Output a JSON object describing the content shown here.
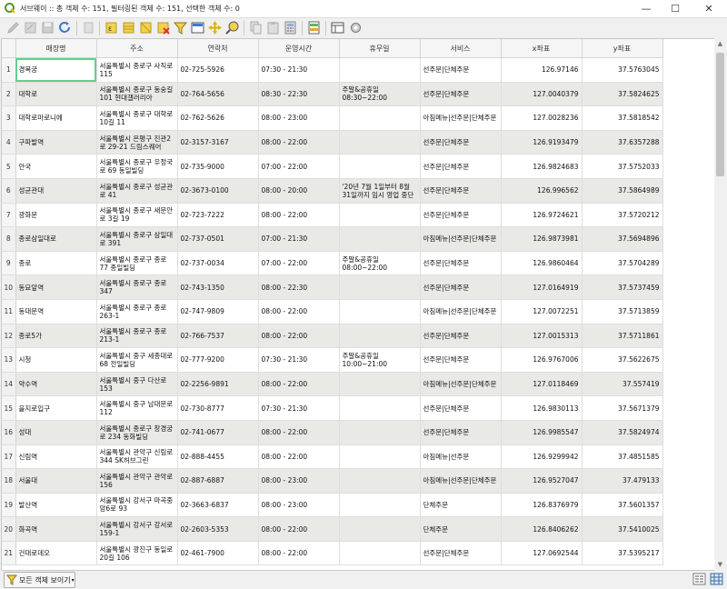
{
  "window": {
    "title": "서브웨이 :: 총 객체 수: 151, 필터링된 객체 수: 151, 선택한 객체 수: 0",
    "minimize": "—",
    "maximize": "☐",
    "close": "✕"
  },
  "toolbar": {
    "icons": [
      "edit-pencil-icon",
      "multi-edit-icon",
      "save-icon",
      "reload-icon",
      "add-feature-icon",
      "delete-feature-icon",
      "select-expression-icon",
      "select-all-icon",
      "invert-selection-icon",
      "deselect-icon",
      "filter-icon",
      "move-selection-top-icon",
      "pan-to-selection-icon",
      "zoom-to-selection-icon",
      "copy-icon",
      "paste-icon",
      "field-calculator-icon",
      "conditional-formatting-icon",
      "dock-table-icon",
      "actions-icon"
    ]
  },
  "table": {
    "columns": [
      "매장명",
      "주소",
      "연락처",
      "운영시간",
      "휴무일",
      "서비스",
      "x좌표",
      "y좌표"
    ],
    "rows": [
      {
        "n": "1",
        "name": "경복궁",
        "addr": "서울특별시 종로구 사직로 115",
        "tel": "02-725-5926",
        "hours": "07:30 - 21:30",
        "off": "",
        "svc": "선주문|단체주문",
        "x": "126.97146",
        "y": "37.5763045"
      },
      {
        "n": "2",
        "name": "대학로",
        "addr": "서울특별시 종로구 동숭길 101 현대갤러리아",
        "tel": "02-764-5656",
        "hours": "08:30 - 22:30",
        "off": "주말&공휴일 08:30~22:00",
        "svc": "선주문|단체주문",
        "x": "127.0040379",
        "y": "37.5824625"
      },
      {
        "n": "3",
        "name": "대학로마로니에",
        "addr": "서울특별시 종로구 대학로10길 11",
        "tel": "02-762-5626",
        "hours": "08:00 - 23:00",
        "off": "",
        "svc": "아침메뉴|선주문|단체주문",
        "x": "127.0028236",
        "y": "37.5818542"
      },
      {
        "n": "4",
        "name": "구파발역",
        "addr": "서울특별시 은평구 진관2로 29-21 드림스퀘어",
        "tel": "02-3157-3167",
        "hours": "08:00 - 22:00",
        "off": "",
        "svc": "선주문|단체주문",
        "x": "126.9193479",
        "y": "37.6357288"
      },
      {
        "n": "5",
        "name": "안국",
        "addr": "서울특별시 종로구 우정국로 69 동일빌딩",
        "tel": "02-735-9000",
        "hours": "07:00 - 22:00",
        "off": "",
        "svc": "선주문|단체주문",
        "x": "126.9824683",
        "y": "37.5752033"
      },
      {
        "n": "6",
        "name": "성균관대",
        "addr": "서울특별시 종로구 성균관로 41",
        "tel": "02-3673-0100",
        "hours": "08:00 - 20:00",
        "off": "'20년 7월 1일부터 8월 31일까지 임시 영업 중단",
        "svc": "선주문|단체주문",
        "x": "126.996562",
        "y": "37.5864989"
      },
      {
        "n": "7",
        "name": "광화문",
        "addr": "서울특별시 종로구 새문안로 3길 19",
        "tel": "02-723-7222",
        "hours": "08:00 - 22:00",
        "off": "",
        "svc": "선주문|단체주문",
        "x": "126.9724621",
        "y": "37.5720212"
      },
      {
        "n": "8",
        "name": "종로삼일대로",
        "addr": "서울특별시 종로구 삼일대로 391",
        "tel": "02-737-0501",
        "hours": "07:00 - 21:30",
        "off": "",
        "svc": "아침메뉴|선주문|단체주문",
        "x": "126.9873981",
        "y": "37.5694896"
      },
      {
        "n": "9",
        "name": "종로",
        "addr": "서울특별시 종로구 종로 77 종일빌딩",
        "tel": "02-737-0034",
        "hours": "07:00 - 22:00",
        "off": "주말&공휴일 08:00~22:00",
        "svc": "선주문|단체주문",
        "x": "126.9860464",
        "y": "37.5704289"
      },
      {
        "n": "10",
        "name": "동묘앞역",
        "addr": "서울특별시 종로구 종로 347",
        "tel": "02-743-1350",
        "hours": "08:00 - 22:30",
        "off": "",
        "svc": "선주문|단체주문",
        "x": "127.0164919",
        "y": "37.5737459"
      },
      {
        "n": "11",
        "name": "동대문역",
        "addr": "서울특별시 종로구 종로 263-1",
        "tel": "02-747-9809",
        "hours": "08:00 - 22:00",
        "off": "",
        "svc": "아침메뉴|선주문|단체주문",
        "x": "127.0072251",
        "y": "37.5713859"
      },
      {
        "n": "12",
        "name": "종로5가",
        "addr": "서울특별시 종로구 종로 213-1",
        "tel": "02-766-7537",
        "hours": "08:00 - 22:00",
        "off": "",
        "svc": "선주문|단체주문",
        "x": "127.0015313",
        "y": "37.5711861"
      },
      {
        "n": "13",
        "name": "시청",
        "addr": "서울특별시 중구 세종대로 68 전일빌딩",
        "tel": "02-777-9200",
        "hours": "07:30 - 21:30",
        "off": "주말&공휴일 10:00~21:00",
        "svc": "선주문|단체주문",
        "x": "126.9767006",
        "y": "37.5622675"
      },
      {
        "n": "14",
        "name": "약수역",
        "addr": "서울특별시 중구 다산로 153",
        "tel": "02-2256-9891",
        "hours": "08:00 - 22:00",
        "off": "",
        "svc": "아침메뉴|선주문|단체주문",
        "x": "127.0118469",
        "y": "37.557419"
      },
      {
        "n": "15",
        "name": "을지로입구",
        "addr": "서울특별시 중구 남대문로 112",
        "tel": "02-730-8777",
        "hours": "07:30 - 21:30",
        "off": "",
        "svc": "선주문|단체주문",
        "x": "126.9830113",
        "y": "37.5671379"
      },
      {
        "n": "16",
        "name": "성대",
        "addr": "서울특별시 종로구 창경궁로 234 동화빌딩",
        "tel": "02-741-0677",
        "hours": "08:00 - 22:00",
        "off": "",
        "svc": "선주문|단체주문",
        "x": "126.9985547",
        "y": "37.5824974"
      },
      {
        "n": "17",
        "name": "신림역",
        "addr": "서울특별시 관악구 신림로 344 SK허브그린",
        "tel": "02-888-4455",
        "hours": "08:00 - 22:00",
        "off": "",
        "svc": "아침메뉴|선주문",
        "x": "126.9299942",
        "y": "37.4851585"
      },
      {
        "n": "18",
        "name": "서울대",
        "addr": "서울특별시 관악구 관악로 156",
        "tel": "02-887-6887",
        "hours": "08:00 - 23:00",
        "off": "",
        "svc": "아침메뉴|선주문|단체주문",
        "x": "126.9527047",
        "y": "37.479133"
      },
      {
        "n": "19",
        "name": "발산역",
        "addr": "서울특별시 강서구 마곡중앙6로 93",
        "tel": "02-3663-6837",
        "hours": "08:00 - 23:00",
        "off": "",
        "svc": "단체주문",
        "x": "126.8376979",
        "y": "37.5601357"
      },
      {
        "n": "20",
        "name": "화곡역",
        "addr": "서울특별시 강서구 강서로 159-1",
        "tel": "02-2603-5353",
        "hours": "08:00 - 22:00",
        "off": "",
        "svc": "단체주문",
        "x": "126.8406262",
        "y": "37.5410025"
      },
      {
        "n": "21",
        "name": "건대로데오",
        "addr": "서울특별시 광진구 동일로20길 106",
        "tel": "02-461-7900",
        "hours": "08:00 - 22:00",
        "off": "",
        "svc": "선주문|단체주문",
        "x": "127.0692544",
        "y": "37.5395217"
      }
    ]
  },
  "bottom": {
    "show_all_label": "모든 객체 보이기"
  },
  "colors": {
    "selected_cell_border": "#5fd18e",
    "alt_row": "#e9e9e6",
    "qgis_green": "#589632"
  }
}
